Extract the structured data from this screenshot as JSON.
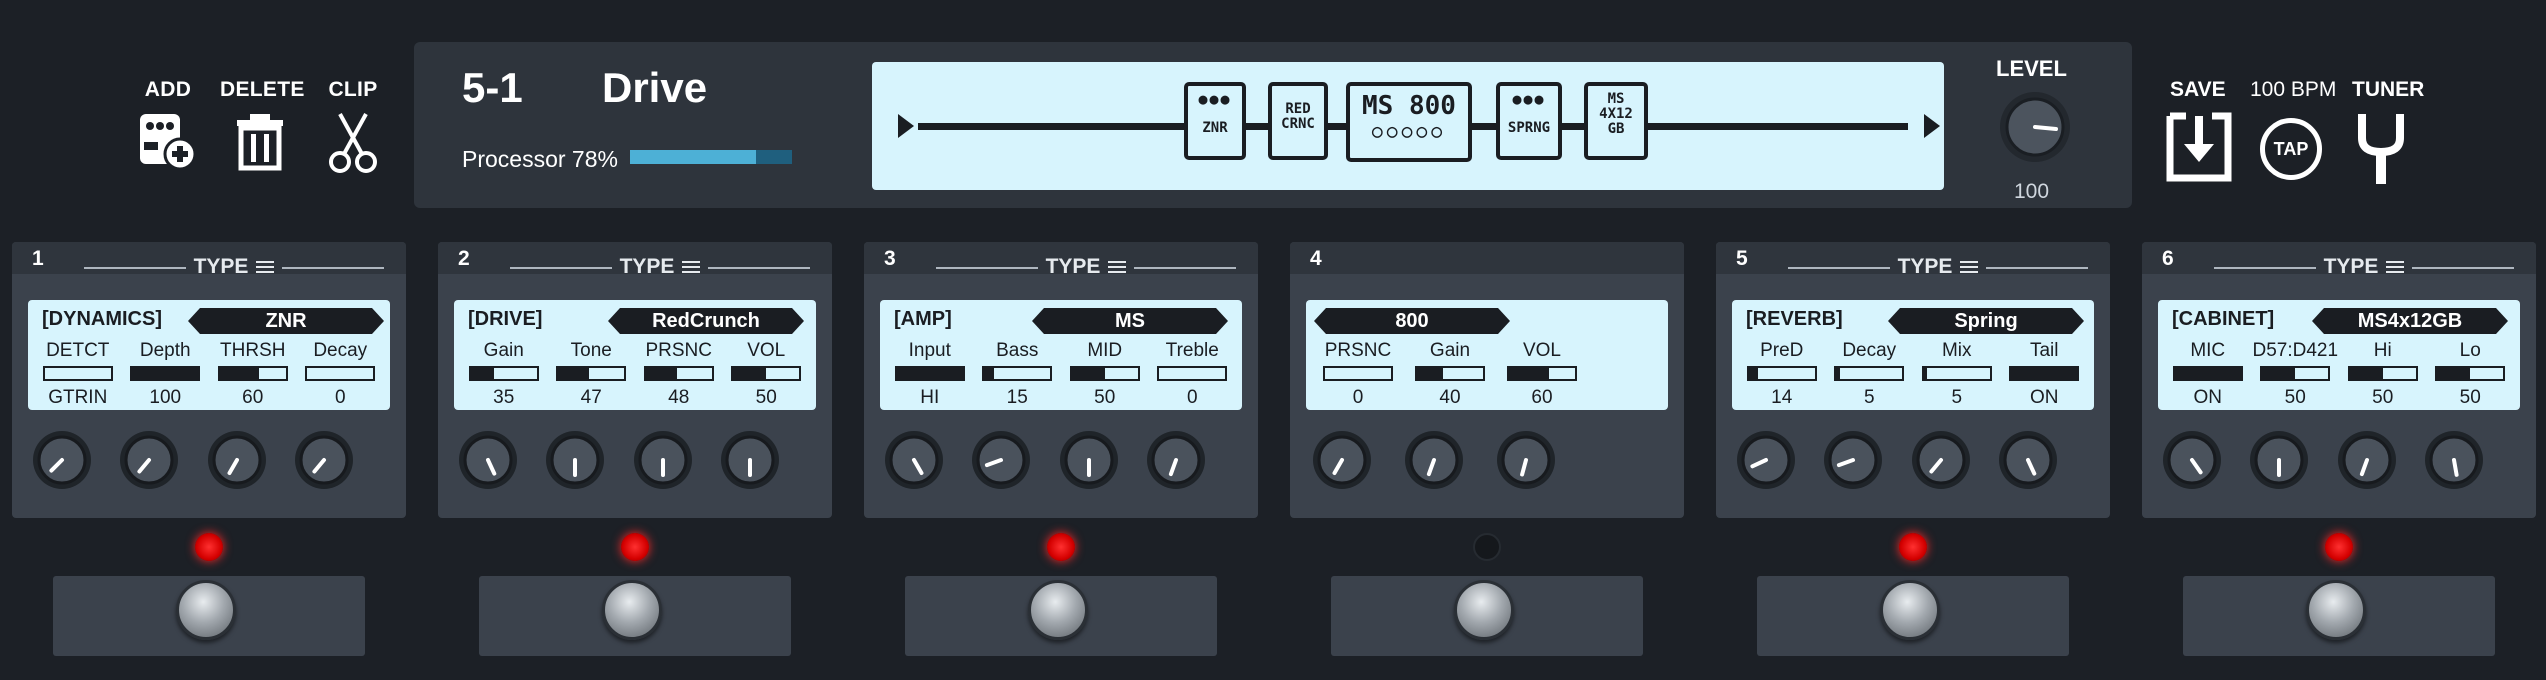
{
  "toolbar": {
    "add_label": "ADD",
    "delete_label": "DELETE",
    "clip_label": "CLIP"
  },
  "preset": {
    "number": "5-1",
    "name": "Drive",
    "processor_label": "Processor 78%",
    "processor_usage": 0.78
  },
  "chain": {
    "blocks": [
      {
        "line1": "●●●",
        "line2": "ZNR"
      },
      {
        "line1": "RED",
        "line2": "CRNC"
      },
      {
        "line1": "MS 800",
        "line2": "○○○○○"
      },
      {
        "line1": "●●●",
        "line2": "SPRNG"
      },
      {
        "line1": "MS",
        "line2": "4X12",
        "line3": "GB"
      }
    ]
  },
  "level": {
    "label": "LEVEL",
    "value": "100"
  },
  "right_controls": {
    "save_label": "SAVE",
    "bpm_label": "100 BPM",
    "tap_label": "TAP",
    "tuner_label": "TUNER"
  },
  "slots": [
    {
      "number": "1",
      "type_label": "TYPE",
      "category": "[DYNAMICS]",
      "model": "ZNR",
      "active": true,
      "params": [
        {
          "name": "DETCT",
          "value": "GTRIN",
          "fill": 0
        },
        {
          "name": "Depth",
          "value": "100",
          "fill": 1.0
        },
        {
          "name": "THRSH",
          "value": "60",
          "fill": 0.6
        },
        {
          "name": "Decay",
          "value": "0",
          "fill": 0
        }
      ]
    },
    {
      "number": "2",
      "type_label": "TYPE",
      "category": "[DRIVE]",
      "model": "RedCrunch",
      "active": true,
      "params": [
        {
          "name": "Gain",
          "value": "35",
          "fill": 0.35
        },
        {
          "name": "Tone",
          "value": "47",
          "fill": 0.47
        },
        {
          "name": "PRSNC",
          "value": "48",
          "fill": 0.48
        },
        {
          "name": "VOL",
          "value": "50",
          "fill": 0.5
        }
      ]
    },
    {
      "number": "3",
      "type_label": "TYPE",
      "category": "[AMP]",
      "model": "MS",
      "active": true,
      "params": [
        {
          "name": "Input",
          "value": "HI",
          "fill": 1.0
        },
        {
          "name": "Bass",
          "value": "15",
          "fill": 0.15
        },
        {
          "name": "MID",
          "value": "50",
          "fill": 0.5
        },
        {
          "name": "Treble",
          "value": "0",
          "fill": 0
        }
      ]
    },
    {
      "number": "4",
      "type_label": "",
      "category": "",
      "model": "800",
      "active": false,
      "params": [
        {
          "name": "PRSNC",
          "value": "0",
          "fill": 0
        },
        {
          "name": "Gain",
          "value": "40",
          "fill": 0.4
        },
        {
          "name": "VOL",
          "value": "60",
          "fill": 0.6
        }
      ]
    },
    {
      "number": "5",
      "type_label": "TYPE",
      "category": "[REVERB]",
      "model": "Spring",
      "active": true,
      "params": [
        {
          "name": "PreD",
          "value": "14",
          "fill": 0.14
        },
        {
          "name": "Decay",
          "value": "5",
          "fill": 0.05
        },
        {
          "name": "Mix",
          "value": "5",
          "fill": 0.05
        },
        {
          "name": "Tail",
          "value": "ON",
          "fill": 1.0
        }
      ]
    },
    {
      "number": "6",
      "type_label": "TYPE",
      "category": "[CABINET]",
      "model": "MS4x12GB",
      "active": true,
      "params": [
        {
          "name": "MIC",
          "value": "ON",
          "fill": 1.0
        },
        {
          "name": "D57:D421",
          "value": "50",
          "fill": 0.5
        },
        {
          "name": "Hi",
          "value": "50",
          "fill": 0.5
        },
        {
          "name": "Lo",
          "value": "50",
          "fill": 0.5
        }
      ]
    }
  ],
  "colors": {
    "background": "#1c2026",
    "panel": "#3b424c",
    "screen": "#d7f4fd",
    "led_on": "#ff2020",
    "processor_bar": "#4db0d6"
  }
}
